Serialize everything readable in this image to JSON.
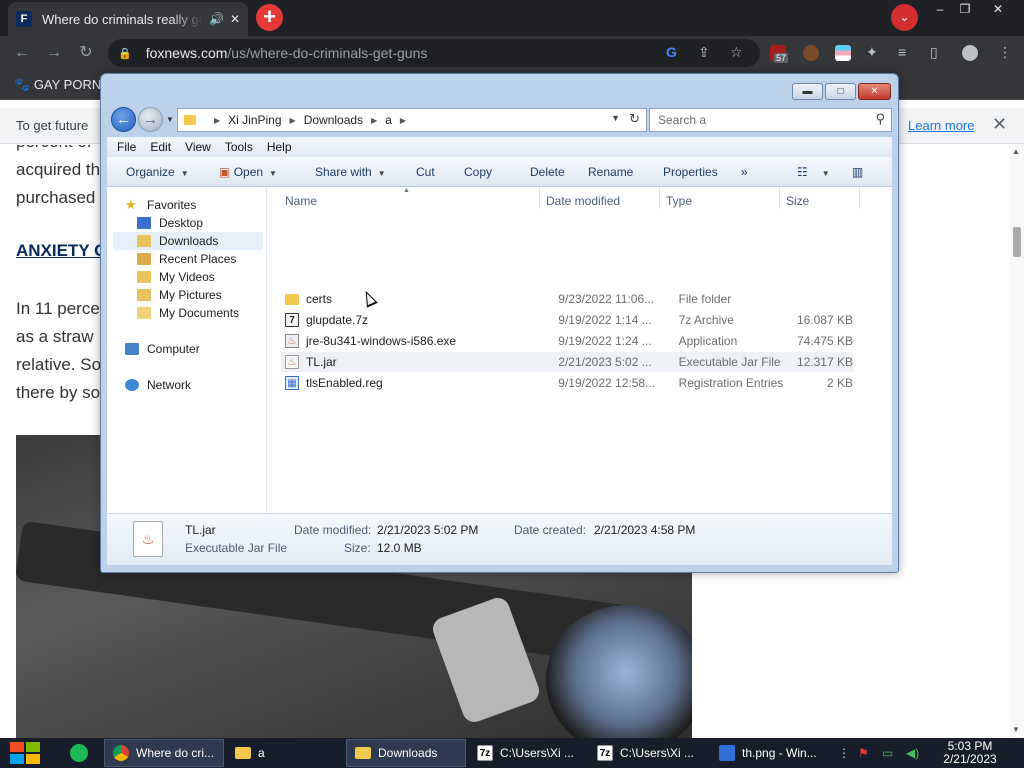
{
  "browser": {
    "tab_title": "Where do criminals really get",
    "tab_favicon": "F",
    "newtab_icon": "+",
    "tab_search_icon": "⌄",
    "win_min": "–",
    "win_restore": "❐",
    "win_close": "✕",
    "nav_back": "←",
    "nav_forward": "→",
    "nav_reload": "↻",
    "url_domain": "foxnews.com",
    "url_path": "/us/where-do-criminals-get-guns",
    "ext_badge": "57",
    "bookmark_label": "GAY PORN",
    "info_text": "To get future",
    "learn_more": "Learn more",
    "info_close": "✕"
  },
  "article": {
    "lines": [
      "percent of",
      "acquired th",
      "purchased",
      "In 11 perce",
      "as a straw",
      "relative. So",
      "there by so"
    ],
    "heading": "ANXIETY C"
  },
  "explorer": {
    "breadcrumb": [
      "Xi JinPing",
      "Downloads",
      "a"
    ],
    "search_placeholder": "Search a",
    "menu": [
      "File",
      "Edit",
      "View",
      "Tools",
      "Help"
    ],
    "commands": {
      "organize": "Organize",
      "open": "Open",
      "share": "Share with",
      "cut": "Cut",
      "copy": "Copy",
      "delete": "Delete",
      "rename": "Rename",
      "properties": "Properties",
      "more": "»"
    },
    "nav": {
      "favorites": "Favorites",
      "desktop": "Desktop",
      "downloads": "Downloads",
      "recent": "Recent Places",
      "videos": "My Videos",
      "pictures": "My Pictures",
      "documents": "My Documents",
      "computer": "Computer",
      "network": "Network"
    },
    "columns": [
      "Name",
      "Date modified",
      "Type",
      "Size"
    ],
    "files": [
      {
        "name": "certs",
        "date": "9/23/2022 11:06...",
        "type": "File folder",
        "size": "",
        "icon": "folder-icon"
      },
      {
        "name": "glupdate.7z",
        "date": "9/19/2022 1:14 ...",
        "type": "7z Archive",
        "size": "16.087 KB",
        "icon": "7z-archive-icon"
      },
      {
        "name": "jre-8u341-windows-i586.exe",
        "date": "9/19/2022 1:24 ...",
        "type": "Application",
        "size": "74.475 KB",
        "icon": "installer-icon"
      },
      {
        "name": "TL.jar",
        "date": "2/21/2023 5:02 ...",
        "type": "Executable Jar File",
        "size": "12.317 KB",
        "icon": "jar-file-icon"
      },
      {
        "name": "tlsEnabled.reg",
        "date": "9/19/2022 12:58...",
        "type": "Registration Entries",
        "size": "2 KB",
        "icon": "registry-file-icon"
      }
    ],
    "details": {
      "filename": "TL.jar",
      "filetype": "Executable Jar File",
      "modified_label": "Date modified:",
      "modified_value": "2/21/2023 5:02 PM",
      "created_label": "Date created:",
      "created_value": "2/21/2023 4:58 PM",
      "size_label": "Size:",
      "size_value": "12.0 MB"
    }
  },
  "taskbar": {
    "items": [
      {
        "label": "Where do cri...",
        "icon": "chrome-icon"
      },
      {
        "label": "a",
        "icon": "folder-icon"
      },
      {
        "label": "Downloads",
        "icon": "folder-icon"
      },
      {
        "label": "C:\\Users\\Xi ...",
        "icon": "7zip-icon"
      },
      {
        "label": "C:\\Users\\Xi ...",
        "icon": "7zip-icon"
      },
      {
        "label": "th.png - Win...",
        "icon": "photo-viewer-icon"
      }
    ],
    "time": "5:03 PM",
    "date": "2/21/2023"
  },
  "colors": {
    "chrome_dark": "#35363a",
    "accent_red": "#e53935",
    "fox_navy": "#0b2c5c",
    "explorer_frame": "#bcd1ea",
    "taskbar": "#171d2a",
    "link_blue": "#1a73e8"
  }
}
